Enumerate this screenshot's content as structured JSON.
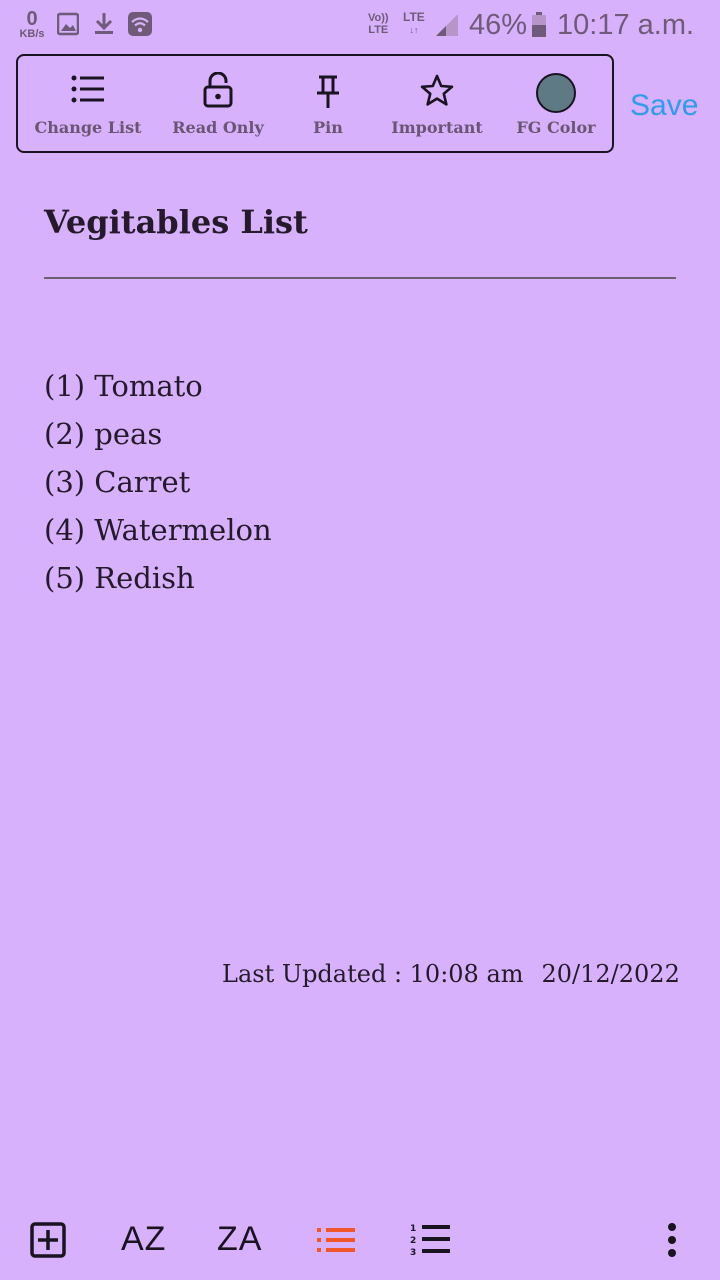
{
  "status_bar": {
    "net_speed_value": "0",
    "net_speed_unit": "KB/s",
    "volte_line1": "Vo))",
    "volte_line2": "LTE",
    "lte_label": "LTE",
    "battery_percent": "46%",
    "time": "10:17 a.m."
  },
  "toolbar": {
    "change_list_label": "Change List",
    "read_only_label": "Read Only",
    "pin_label": "Pin",
    "important_label": "Important",
    "fg_color_label": "FG Color",
    "fg_color_value": "#5e7b85",
    "save_label": "Save"
  },
  "note": {
    "title": "Vegitables List",
    "items": [
      "(1) Tomato",
      "(2) peas",
      "(3) Carret",
      "(4) Watermelon",
      "(5) Redish"
    ],
    "last_updated_label": "Last Updated : 10:08 am",
    "last_updated_date": "20/12/2022"
  },
  "bottom_bar": {
    "sort_az_label": "AZ",
    "sort_za_label": "ZA",
    "active_color": "#f0562a",
    "icons": [
      "add-box-icon",
      "bullet-list-icon",
      "numbered-list-icon",
      "more-vert-icon"
    ]
  },
  "colors": {
    "background": "#d7b1fb",
    "save_blue": "#2d9cf0"
  }
}
